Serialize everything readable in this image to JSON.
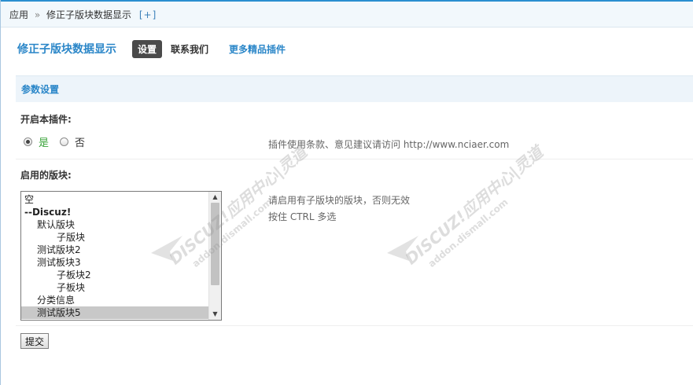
{
  "breadcrumb": {
    "root": "应用",
    "separator": "»",
    "current": "修正子版块数据显示",
    "add": "[+]"
  },
  "header": {
    "plugin_title": "修正子版块数据显示",
    "tabs": [
      {
        "label": "设置",
        "active": true
      },
      {
        "label": "联系我们",
        "active": false
      },
      {
        "label": "更多精品插件",
        "active": false
      }
    ]
  },
  "section": {
    "title": "参数设置"
  },
  "enable_plugin": {
    "label": "开启本插件:",
    "options": [
      {
        "label": "是",
        "checked": true
      },
      {
        "label": "否",
        "checked": false
      }
    ],
    "tip": "插件使用条款、意见建议请访问 http://www.nciaer.com"
  },
  "forums": {
    "label": "启用的版块:",
    "options": [
      {
        "label": "空",
        "level": 0,
        "bold": false,
        "selected": false
      },
      {
        "label": "--Discuz!",
        "level": 0,
        "bold": true,
        "selected": false
      },
      {
        "label": "默认版块",
        "level": 1,
        "bold": false,
        "selected": false
      },
      {
        "label": "子版块",
        "level": 2,
        "bold": false,
        "selected": false
      },
      {
        "label": "测试版块2",
        "level": 1,
        "bold": false,
        "selected": false
      },
      {
        "label": "测试板块3",
        "level": 1,
        "bold": false,
        "selected": false
      },
      {
        "label": "子板块2",
        "level": 2,
        "bold": false,
        "selected": false
      },
      {
        "label": "子板块",
        "level": 2,
        "bold": false,
        "selected": false
      },
      {
        "label": "分类信息",
        "level": 1,
        "bold": false,
        "selected": false
      },
      {
        "label": "测试版块5",
        "level": 1,
        "bold": false,
        "selected": true
      }
    ],
    "tip_line1": "请启用有子版块的版块，否则无效",
    "tip_line2": "按住 CTRL 多选"
  },
  "submit_label": "提交",
  "watermark": {
    "brand": "DISCUZ!应用中心|灵道",
    "domain": "addon.dismall.com"
  },
  "colors": {
    "link": "#2a86c8",
    "active_tab": "#4a4a4a",
    "section_bg": "#edf4fa",
    "yes_green": "#3aa33a",
    "selected_option": "#c8c8c8"
  }
}
